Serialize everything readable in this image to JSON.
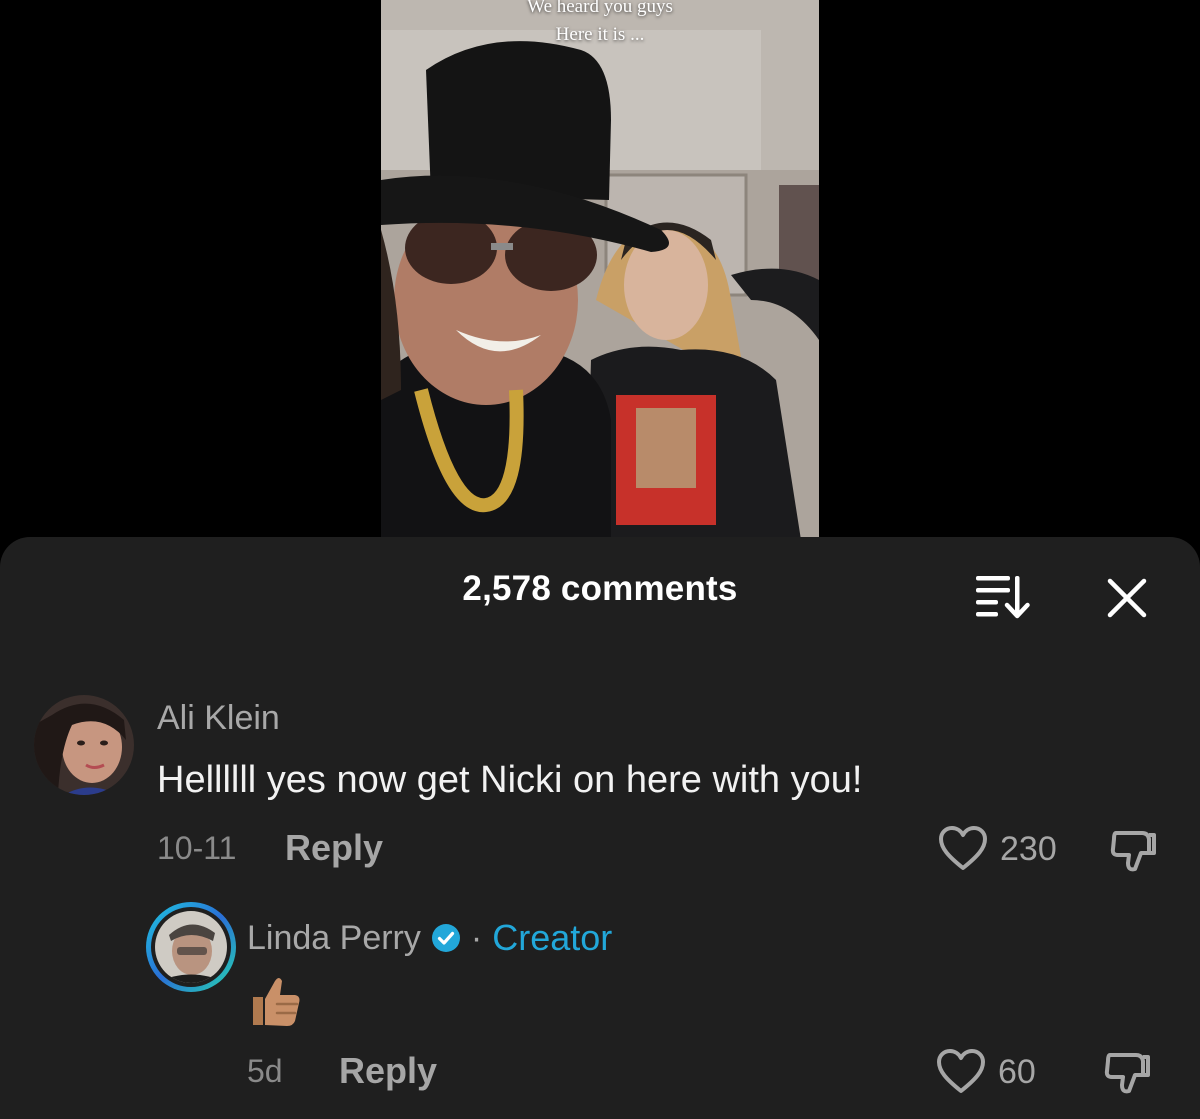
{
  "video": {
    "caption_line1": "We heard you guys",
    "caption_line2": "Here it is ..."
  },
  "comments_sheet": {
    "count_label": "2,578 comments",
    "sort_icon": "sort-icon",
    "close_icon": "close-icon"
  },
  "comments": [
    {
      "username": "Ali Klein",
      "text": "Hellllll yes now get Nicki on here with you!",
      "date": "10-11",
      "reply_label": "Reply",
      "likes": "230"
    }
  ],
  "replies": [
    {
      "username": "Linda Perry",
      "verified": true,
      "separator": "·",
      "badge": "Creator",
      "content_emoji": "thumbs-up",
      "date": "5d",
      "reply_label": "Reply",
      "likes": "60"
    }
  ],
  "colors": {
    "sheet_bg": "#1f1f1f",
    "creator_accent": "#22a7d9",
    "verified_badge": "#22a7d9",
    "text_secondary": "#a8a8a8"
  }
}
